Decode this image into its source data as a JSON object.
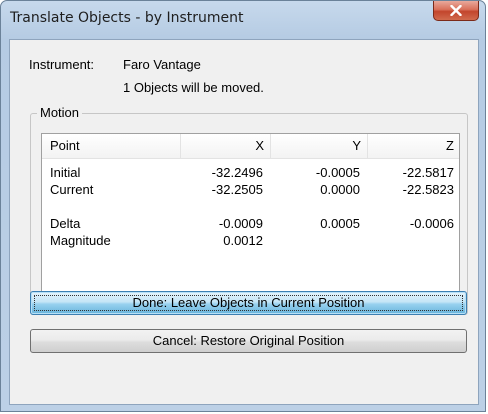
{
  "window": {
    "title": "Translate Objects - by Instrument",
    "close_icon": "close-icon"
  },
  "instrument": {
    "label": "Instrument:",
    "value": "Faro Vantage",
    "note": "1 Objects will be moved."
  },
  "motion": {
    "legend": "Motion",
    "columns": [
      "Point",
      "X",
      "Y",
      "Z"
    ],
    "rows": [
      {
        "point": "Initial",
        "x": "-32.2496",
        "y": "-0.0005",
        "z": "-22.5817"
      },
      {
        "point": "Current",
        "x": "-32.2505",
        "y": "0.0000",
        "z": "-22.5823"
      },
      {
        "point": "",
        "x": "",
        "y": "",
        "z": ""
      },
      {
        "point": "Delta",
        "x": "-0.0009",
        "y": "0.0005",
        "z": "-0.0006"
      },
      {
        "point": "Magnitude",
        "x": "0.0012",
        "y": "",
        "z": ""
      }
    ]
  },
  "buttons": {
    "done": "Done: Leave Objects in Current Position",
    "cancel": "Cancel: Restore Original Position"
  },
  "colors": {
    "close_button": "#c2452c",
    "default_button": "#98d1ef"
  }
}
